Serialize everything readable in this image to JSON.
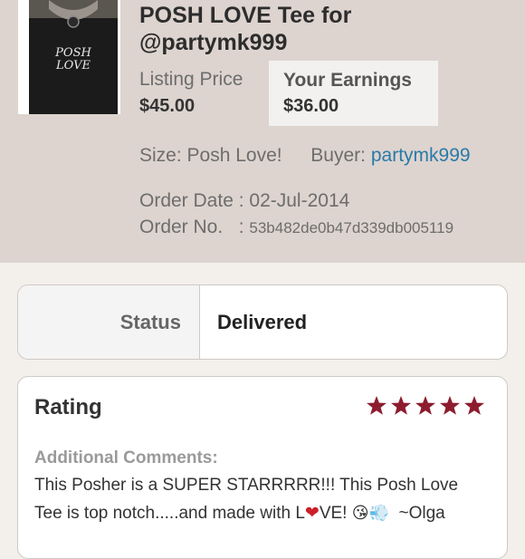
{
  "listing": {
    "title_line1": "POSH LOVE Tee for",
    "title_line2": "@partymk999",
    "listing_price_label": "Listing Price",
    "listing_price": "$45.00",
    "earnings_label": "Your Earnings",
    "earnings": "$36.00",
    "size_label": "Size:",
    "size_value": "Posh Love!",
    "buyer_label": "Buyer:",
    "buyer_value": "partymk999",
    "order_date_label": "Order Date",
    "order_date_sep": " : ",
    "order_date_value": "02-Jul-2014",
    "order_no_label": "Order No.",
    "order_no_sep": "   : ",
    "order_no_value": "53b482de0b47d339db005119"
  },
  "shirt_print": {
    "line1": "POSH",
    "line2": "LOVE"
  },
  "status": {
    "label": "Status",
    "value": "Delivered"
  },
  "rating": {
    "title": "Rating",
    "stars": 5,
    "comments_label": "Additional Comments:",
    "comment_line1": "This Posher is a SUPER STARRRRR!!! This Posh Love",
    "comment_line2_a": "Tee is top notch.....and made with L",
    "comment_line2_heart": "❤",
    "comment_line2_b": "VE! ",
    "comment_line2_emoji": "😘💨",
    "comment_line2_c": "  ~Olga"
  },
  "colors": {
    "header_bg": "#ddd4cf",
    "star": "#8d1c2e",
    "link": "#2a79a8",
    "heart": "#cc1f2a"
  }
}
